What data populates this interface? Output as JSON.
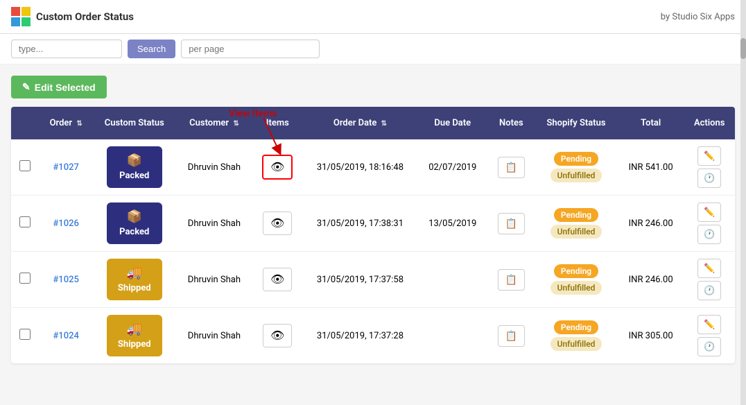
{
  "app": {
    "title": "Custom Order Status",
    "byline": "by Studio Six Apps"
  },
  "filter_bar": {
    "search_placeholder": "type...",
    "search_btn_label": "Search",
    "per_page_placeholder": "per page"
  },
  "edit_selected_btn": "Edit Selected",
  "annotation": {
    "label": "View Items"
  },
  "table": {
    "columns": [
      {
        "key": "checkbox",
        "label": ""
      },
      {
        "key": "order",
        "label": "Order",
        "sortable": true
      },
      {
        "key": "custom_status",
        "label": "Custom Status"
      },
      {
        "key": "customer",
        "label": "Customer",
        "sortable": true
      },
      {
        "key": "items",
        "label": "Items"
      },
      {
        "key": "order_date",
        "label": "Order Date",
        "sortable": true
      },
      {
        "key": "due_date",
        "label": "Due Date"
      },
      {
        "key": "notes",
        "label": "Notes"
      },
      {
        "key": "shopify_status",
        "label": "Shopify Status"
      },
      {
        "key": "total",
        "label": "Total"
      },
      {
        "key": "actions",
        "label": "Actions"
      }
    ],
    "rows": [
      {
        "id": "row1",
        "order": "#1027",
        "status_label": "Packed",
        "status_type": "packed",
        "customer": "Dhruvin Shah",
        "order_date": "31/05/2019, 18:16:48",
        "due_date": "02/07/2019",
        "shopify_payment": "Pending",
        "shopify_fulfillment": "Unfulfilled",
        "total": "INR 541.00",
        "highlighted_items": true
      },
      {
        "id": "row2",
        "order": "#1026",
        "status_label": "Packed",
        "status_type": "packed",
        "customer": "Dhruvin Shah",
        "order_date": "31/05/2019, 17:38:31",
        "due_date": "13/05/2019",
        "shopify_payment": "Pending",
        "shopify_fulfillment": "Unfulfilled",
        "total": "INR 246.00",
        "highlighted_items": false
      },
      {
        "id": "row3",
        "order": "#1025",
        "status_label": "Shipped",
        "status_type": "shipped",
        "customer": "Dhruvin Shah",
        "order_date": "31/05/2019, 17:37:58",
        "due_date": "",
        "shopify_payment": "Pending",
        "shopify_fulfillment": "Unfulfilled",
        "total": "INR 246.00",
        "highlighted_items": false
      },
      {
        "id": "row4",
        "order": "#1024",
        "status_label": "Shipped",
        "status_type": "shipped",
        "customer": "Dhruvin Shah",
        "order_date": "31/05/2019, 17:37:28",
        "due_date": "",
        "shopify_payment": "Pending",
        "shopify_fulfillment": "Unfulfilled",
        "total": "INR 305.00",
        "highlighted_items": false
      }
    ]
  }
}
